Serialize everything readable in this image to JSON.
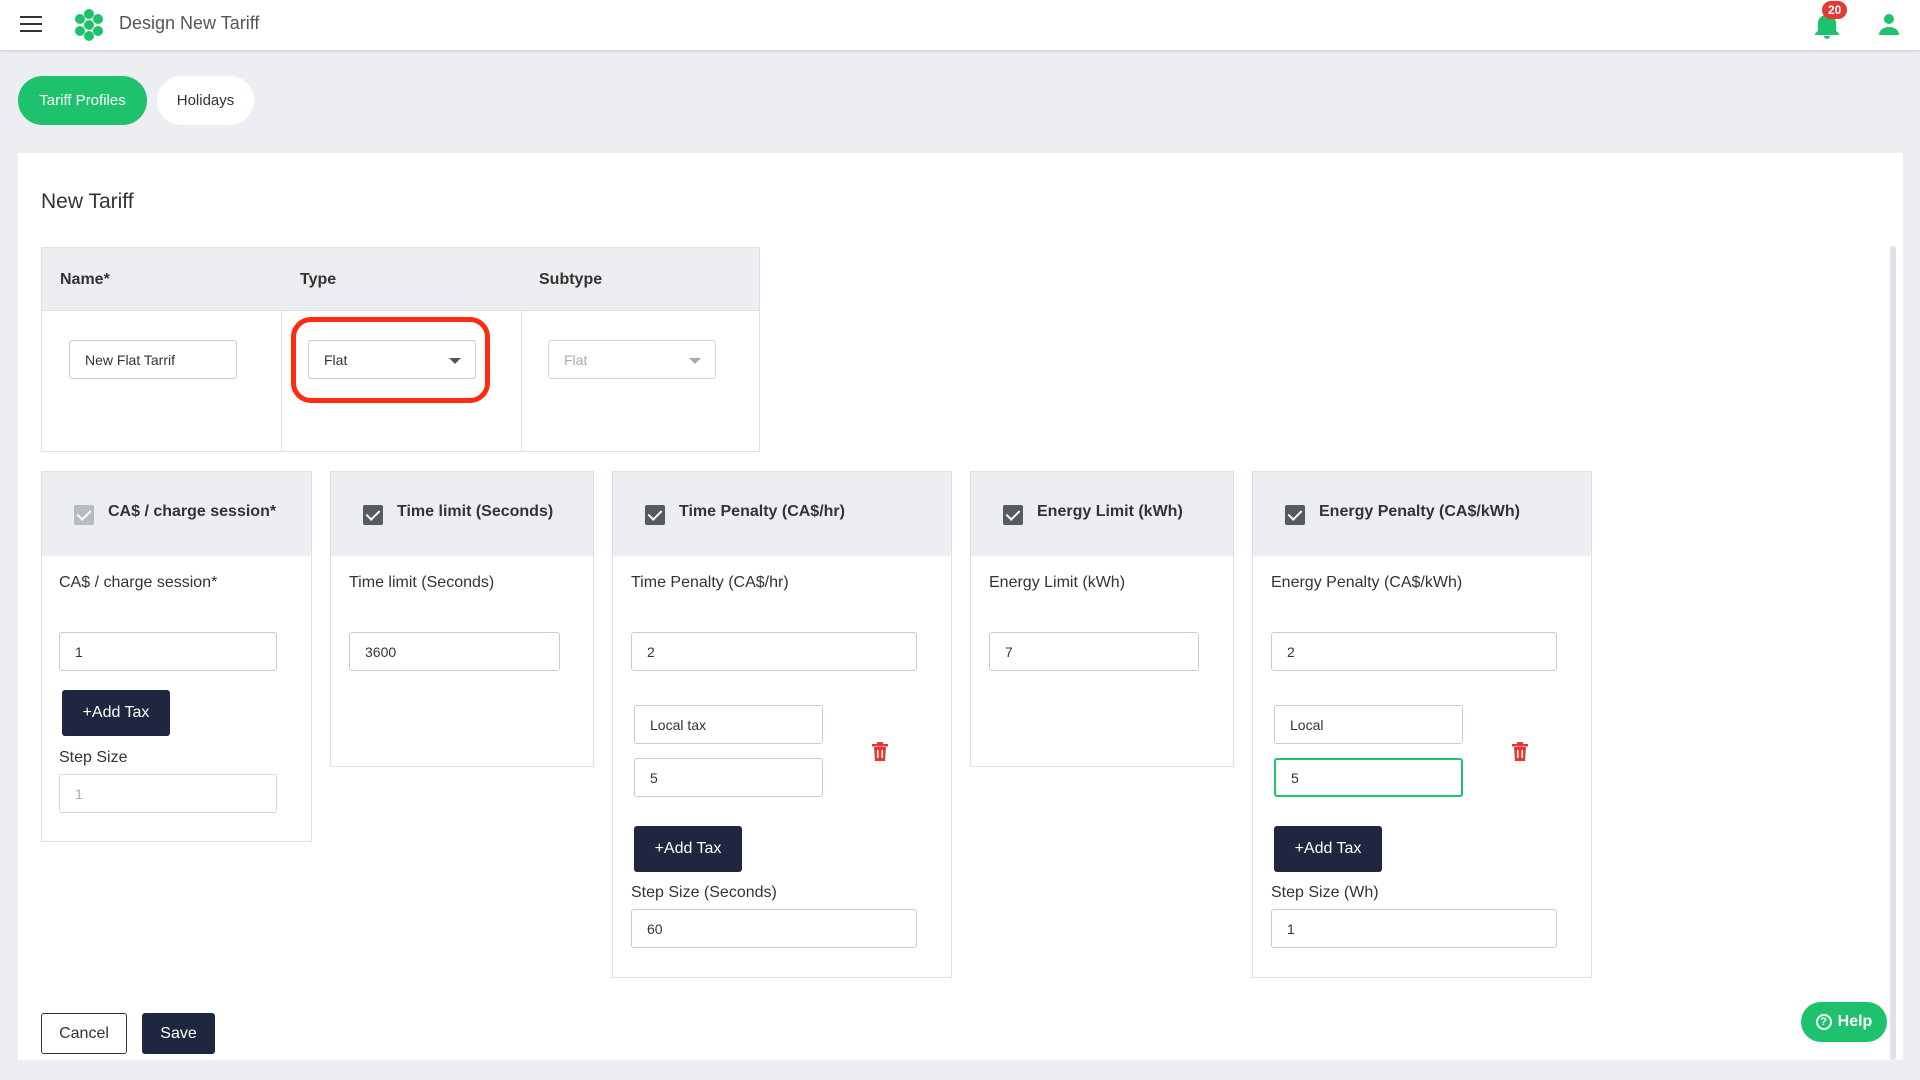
{
  "app": {
    "title": "Design New Tariff",
    "notification_count": "20"
  },
  "tabs": [
    {
      "label": "Tariff Profiles"
    },
    {
      "label": "Holidays"
    }
  ],
  "page": {
    "title": "New Tariff"
  },
  "table": {
    "headers": {
      "name": "Name*",
      "type": "Type",
      "subtype": "Subtype"
    },
    "name_value": "New Flat Tarrif",
    "type_value": "Flat",
    "subtype_value": "Flat"
  },
  "cards": {
    "charge": {
      "title": "CA$ / charge session*",
      "label": "CA$ / charge session*",
      "value": "1",
      "add_tax": "+Add Tax",
      "step_label": "Step Size",
      "step_value": "1"
    },
    "time_limit": {
      "title": "Time limit (Seconds)",
      "label": "Time limit (Seconds)",
      "value": "3600"
    },
    "time_penalty": {
      "title": "Time Penalty (CA$/hr)",
      "label": "Time Penalty (CA$/hr)",
      "value": "2",
      "tax_name": "Local tax",
      "tax_value": "5",
      "add_tax": "+Add Tax",
      "step_label": "Step Size (Seconds)",
      "step_value": "60"
    },
    "energy_limit": {
      "title": "Energy Limit (kWh)",
      "label": "Energy Limit (kWh)",
      "value": "7"
    },
    "energy_penalty": {
      "title": "Energy Penalty (CA$/kWh)",
      "label": "Energy Penalty (CA$/kWh)",
      "value": "2",
      "tax_name": "Local",
      "tax_value": "5",
      "add_tax": "+Add Tax",
      "step_label": "Step Size (Wh)",
      "step_value": "1"
    }
  },
  "footer": {
    "cancel": "Cancel",
    "save": "Save"
  },
  "help": {
    "label": "Help",
    "icon_char": "?"
  },
  "colors": {
    "accent": "#1ec16c",
    "dark": "#1e2640",
    "danger": "#e53935",
    "highlight": "#ff2a12"
  }
}
